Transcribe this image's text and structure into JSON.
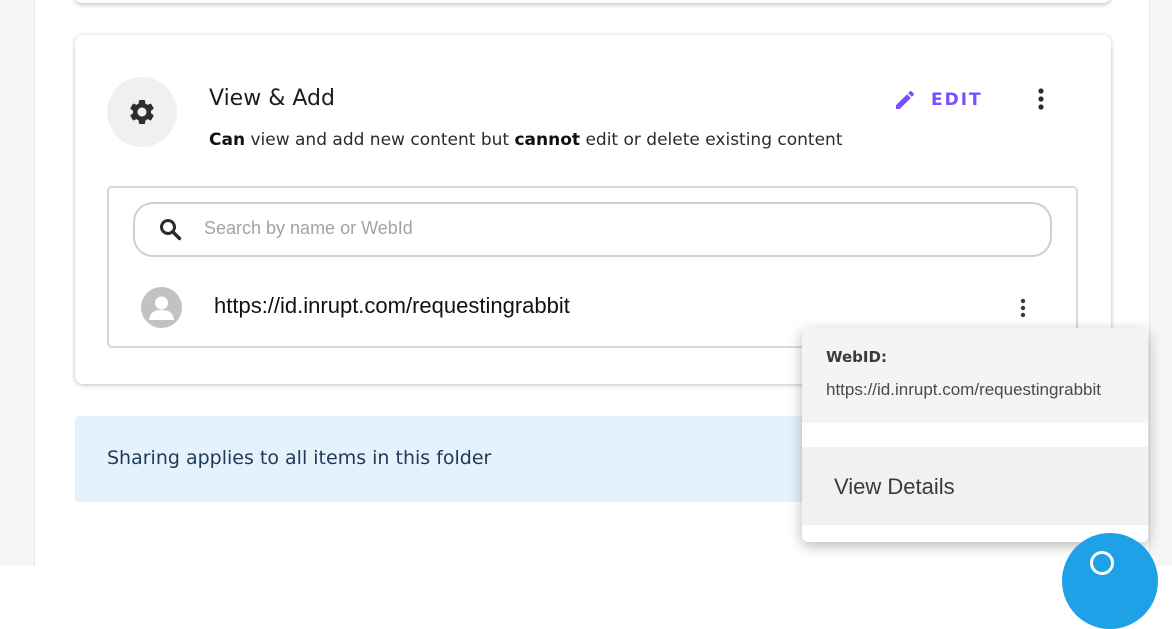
{
  "permission": {
    "title": "View & Add",
    "description": {
      "part1": "Can",
      "part2": " view and add new content but ",
      "part3": "cannot",
      "part4": " edit or delete existing content"
    },
    "edit_label": "EDIT",
    "accent_color": "#7c4dff",
    "icon": "gear-icon"
  },
  "search": {
    "placeholder": "Search by name or WebId",
    "value": ""
  },
  "agents": [
    {
      "url": "https://id.inrupt.com/requestingrabbit",
      "icon": "person-icon"
    }
  ],
  "info": {
    "text": "Sharing applies to all items in this folder",
    "background_color": "#e6f2fb"
  },
  "popover": {
    "label": "WebID:",
    "url": "https://id.inrupt.com/requestingrabbit",
    "items": [
      {
        "label": "View Details"
      }
    ]
  },
  "fab": {
    "color": "#1ea1e6"
  }
}
